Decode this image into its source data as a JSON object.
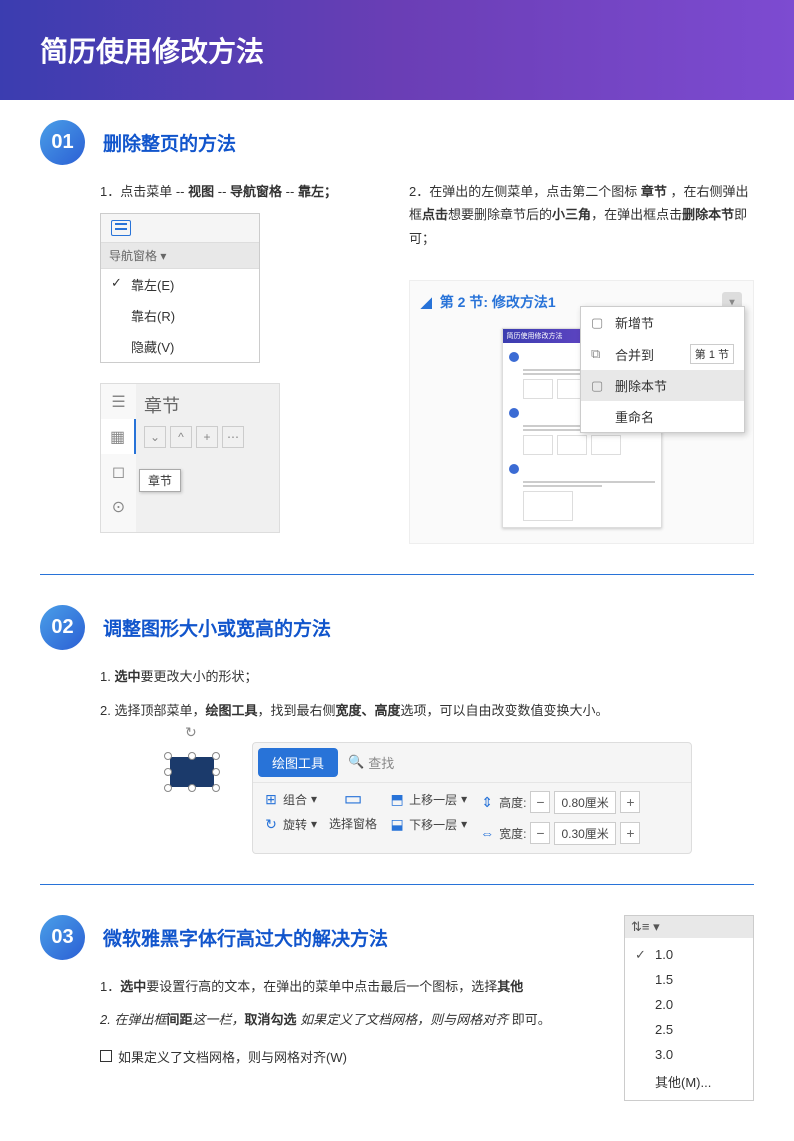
{
  "header": {
    "title": "简历使用修改方法"
  },
  "section1": {
    "number": "01",
    "title": "删除整页的方法",
    "step1_prefix": "1．点击菜单  --  ",
    "step1_b1": "视图",
    "step1_mid1": "  --  ",
    "step1_b2": "导航窗格",
    "step1_mid2": "  --  ",
    "step1_b3": "靠左；",
    "nav_label": "导航窗格",
    "menu_left": "靠左(E)",
    "menu_right": "靠右(R)",
    "menu_hide": "隐藏(V)",
    "sidebar_title": "章节",
    "tooltip_chapter": "章节",
    "step2_prefix": "2．在弹出的左侧菜单，点击第二个图标 ",
    "step2_b1": "章节",
    "step2_mid1": " ，在右侧弹出框",
    "step2_b2": "点击",
    "step2_mid2": "想要删除章节后的",
    "step2_b3": "小三角",
    "step2_mid3": "，在弹出框点击",
    "step2_b4": "删除本节",
    "step2_suffix": "即可；",
    "chapter_label": "第 2 节: 修改方法1",
    "thumb_title": "简历使用修改方法",
    "ctx_new": "新增节",
    "ctx_merge": "合并到",
    "ctx_merge_target": "第 1 节",
    "ctx_delete": "删除本节",
    "ctx_rename": "重命名"
  },
  "section2": {
    "number": "02",
    "title": "调整图形大小或宽高的方法",
    "step1_prefix": "1. ",
    "step1_b1": "选中",
    "step1_suffix": "要更改大小的形状；",
    "step2_prefix": "2. 选择顶部菜单，",
    "step2_b1": "绘图工具",
    "step2_mid1": "，找到最右侧",
    "step2_b2": "宽度、高度",
    "step2_suffix": "选项，可以自由改变数值变换大小。",
    "tab_draw": "绘图工具",
    "search": "查找",
    "btn_group": "组合",
    "btn_rotate": "旋转",
    "btn_select_pane": "选择窗格",
    "btn_up_layer": "上移一层",
    "btn_down_layer": "下移一层",
    "lbl_height": "高度:",
    "lbl_width": "宽度:",
    "val_height": "0.80厘米",
    "val_width": "0.30厘米"
  },
  "section3": {
    "number": "03",
    "title": "微软雅黑字体行高过大的解决方法",
    "step1_prefix": "1．",
    "step1_b1": "选中",
    "step1_mid": "要设置行高的文本，在弹出的菜单中点击最后一个图标，选择",
    "step1_b2": "其他",
    "step2_prefix": "2. 在弹出框",
    "step2_b1": "间距",
    "step2_mid1": "这一栏，",
    "step2_b2": "取消勾选 ",
    "step2_em": "如果定义了文档网格，则与网格对齐",
    "step2_suffix": " 即可。",
    "checkbox_label": "如果定义了文档网格，则与网格对齐(W)",
    "ls_10": "1.0",
    "ls_15": "1.5",
    "ls_20": "2.0",
    "ls_25": "2.5",
    "ls_30": "3.0",
    "ls_other": "其他(M)..."
  }
}
